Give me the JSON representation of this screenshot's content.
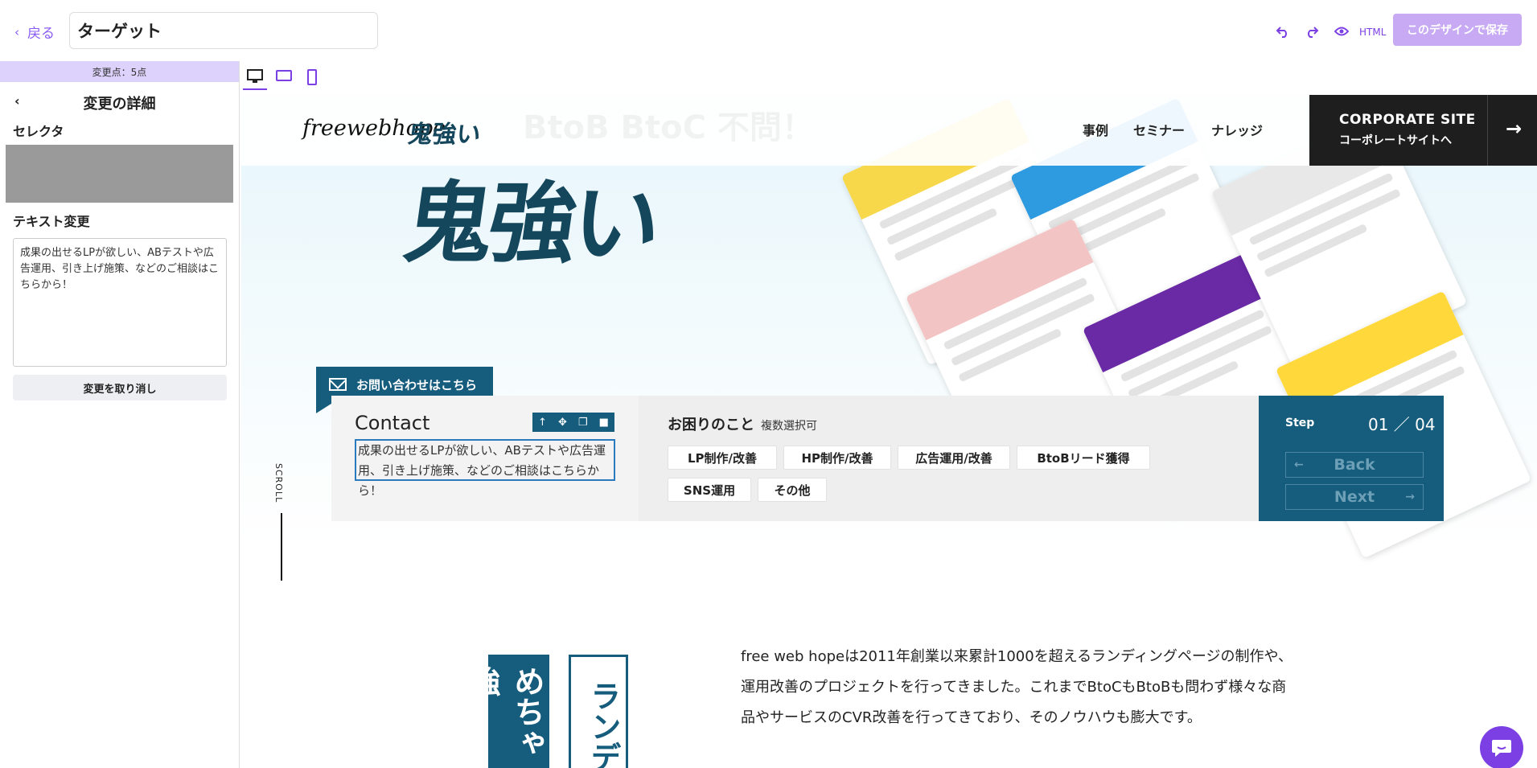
{
  "topbar": {
    "back_label": "戻る",
    "title_value": "ターゲット",
    "html_label": "HTML",
    "save_label": "このデザインで保存",
    "accent": "#7b3fe4"
  },
  "sidebar": {
    "changes_count": "変更点：5点",
    "detail_title": "変更の詳細",
    "selector_label": "セレクタ",
    "text_change_label": "テキスト変更",
    "text_value": "成果の出せるLPが欲しい、ABテストや広告運用、引き上げ施策、などのご相談はこちらから！",
    "undo_label": "変更を取り消し"
  },
  "site": {
    "nav": [
      "事例",
      "セミナー",
      "ナレッジ"
    ],
    "corporate_line1": "CORPORATE SITE",
    "corporate_line2": "コーポレートサイトへ",
    "logo_text": "freewebhope",
    "logo_kanji": "鬼強い",
    "hero_kanji": "鬼強い",
    "bg_tag": "BtoB BtoC 不問！",
    "brand_color": "#155c7d"
  },
  "contact": {
    "tab_label": "お問い合わせはこちら",
    "heading": "Contact",
    "selected_text": "成果の出せるLPが欲しい、ABテストや広告運用、引き上げ施策、などのご相談はこちらから！",
    "trouble_heading": "お困りのこと",
    "multi_select": "複数選択可",
    "options": [
      "LP制作/改善",
      "HP制作/改善",
      "広告運用/改善",
      "BtoBリード獲得",
      "SNS運用",
      "その他"
    ],
    "step_label": "Step",
    "step_value": "01 ／ 04",
    "back_btn": "Back",
    "next_btn": "Next"
  },
  "scroll_label": "SCROLL",
  "intro": {
    "text": "free web hopeは2011年創業以来累計1000を超えるランディングページの制作や、運用改善のプロジェクトを行ってきました。これまでBtoCもBtoBも問わず様々な商品やサービスのCVR改善を行ってきており、そのノウハウも膨大です。",
    "vertical1": "めちゃ強",
    "vertical2": "ランデ"
  }
}
